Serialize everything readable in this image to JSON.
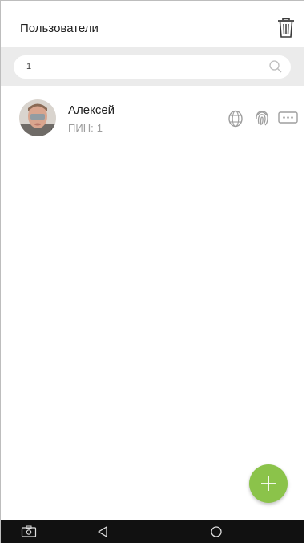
{
  "header": {
    "title": "Пользователи",
    "delete_icon": "trash-icon"
  },
  "search": {
    "value": "1",
    "icon": "search-icon"
  },
  "users": [
    {
      "name": "Алексей",
      "pin_label": "ПИН:",
      "pin": "1",
      "credentials": [
        "face-icon",
        "fingerprint-icon",
        "password-icon"
      ]
    }
  ],
  "fab": {
    "icon": "plus-icon",
    "color": "#8bc34a"
  },
  "navigation": {
    "buttons": [
      "screenshot-icon",
      "back-icon",
      "home-icon"
    ]
  },
  "colors": {
    "accent": "#8bc34a",
    "search_band": "#ebebeb",
    "nav_bar": "#111111"
  }
}
